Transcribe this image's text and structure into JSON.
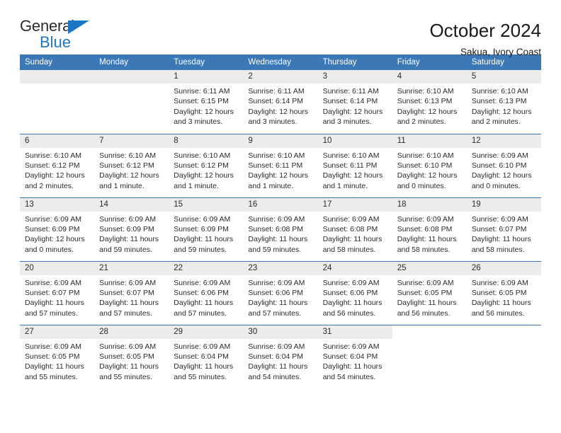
{
  "brand": {
    "name_top": "General",
    "name_bottom": "Blue",
    "accent_color": "#1b77c4"
  },
  "header": {
    "title": "October 2024",
    "subtitle": "Sakua, Ivory Coast"
  },
  "theme": {
    "header_blue": "#3b78b5",
    "daynum_band": "#ececec",
    "text": "#2b2b2b"
  },
  "weekday_headers": [
    "Sunday",
    "Monday",
    "Tuesday",
    "Wednesday",
    "Thursday",
    "Friday",
    "Saturday"
  ],
  "labels": {
    "sunrise_prefix": "Sunrise:",
    "sunset_prefix": "Sunset:",
    "daylight_prefix": "Daylight:"
  },
  "weeks": [
    [
      {
        "day": "",
        "blank": true
      },
      {
        "day": "",
        "blank": true
      },
      {
        "day": "1",
        "sunrise": "Sunrise: 6:11 AM",
        "sunset": "Sunset: 6:15 PM",
        "daylight_1": "Daylight: 12 hours",
        "daylight_2": "and 3 minutes."
      },
      {
        "day": "2",
        "sunrise": "Sunrise: 6:11 AM",
        "sunset": "Sunset: 6:14 PM",
        "daylight_1": "Daylight: 12 hours",
        "daylight_2": "and 3 minutes."
      },
      {
        "day": "3",
        "sunrise": "Sunrise: 6:11 AM",
        "sunset": "Sunset: 6:14 PM",
        "daylight_1": "Daylight: 12 hours",
        "daylight_2": "and 3 minutes."
      },
      {
        "day": "4",
        "sunrise": "Sunrise: 6:10 AM",
        "sunset": "Sunset: 6:13 PM",
        "daylight_1": "Daylight: 12 hours",
        "daylight_2": "and 2 minutes."
      },
      {
        "day": "5",
        "sunrise": "Sunrise: 6:10 AM",
        "sunset": "Sunset: 6:13 PM",
        "daylight_1": "Daylight: 12 hours",
        "daylight_2": "and 2 minutes."
      }
    ],
    [
      {
        "day": "6",
        "sunrise": "Sunrise: 6:10 AM",
        "sunset": "Sunset: 6:12 PM",
        "daylight_1": "Daylight: 12 hours",
        "daylight_2": "and 2 minutes."
      },
      {
        "day": "7",
        "sunrise": "Sunrise: 6:10 AM",
        "sunset": "Sunset: 6:12 PM",
        "daylight_1": "Daylight: 12 hours",
        "daylight_2": "and 1 minute."
      },
      {
        "day": "8",
        "sunrise": "Sunrise: 6:10 AM",
        "sunset": "Sunset: 6:12 PM",
        "daylight_1": "Daylight: 12 hours",
        "daylight_2": "and 1 minute."
      },
      {
        "day": "9",
        "sunrise": "Sunrise: 6:10 AM",
        "sunset": "Sunset: 6:11 PM",
        "daylight_1": "Daylight: 12 hours",
        "daylight_2": "and 1 minute."
      },
      {
        "day": "10",
        "sunrise": "Sunrise: 6:10 AM",
        "sunset": "Sunset: 6:11 PM",
        "daylight_1": "Daylight: 12 hours",
        "daylight_2": "and 1 minute."
      },
      {
        "day": "11",
        "sunrise": "Sunrise: 6:10 AM",
        "sunset": "Sunset: 6:10 PM",
        "daylight_1": "Daylight: 12 hours",
        "daylight_2": "and 0 minutes."
      },
      {
        "day": "12",
        "sunrise": "Sunrise: 6:09 AM",
        "sunset": "Sunset: 6:10 PM",
        "daylight_1": "Daylight: 12 hours",
        "daylight_2": "and 0 minutes."
      }
    ],
    [
      {
        "day": "13",
        "sunrise": "Sunrise: 6:09 AM",
        "sunset": "Sunset: 6:09 PM",
        "daylight_1": "Daylight: 12 hours",
        "daylight_2": "and 0 minutes."
      },
      {
        "day": "14",
        "sunrise": "Sunrise: 6:09 AM",
        "sunset": "Sunset: 6:09 PM",
        "daylight_1": "Daylight: 11 hours",
        "daylight_2": "and 59 minutes."
      },
      {
        "day": "15",
        "sunrise": "Sunrise: 6:09 AM",
        "sunset": "Sunset: 6:09 PM",
        "daylight_1": "Daylight: 11 hours",
        "daylight_2": "and 59 minutes."
      },
      {
        "day": "16",
        "sunrise": "Sunrise: 6:09 AM",
        "sunset": "Sunset: 6:08 PM",
        "daylight_1": "Daylight: 11 hours",
        "daylight_2": "and 59 minutes."
      },
      {
        "day": "17",
        "sunrise": "Sunrise: 6:09 AM",
        "sunset": "Sunset: 6:08 PM",
        "daylight_1": "Daylight: 11 hours",
        "daylight_2": "and 58 minutes."
      },
      {
        "day": "18",
        "sunrise": "Sunrise: 6:09 AM",
        "sunset": "Sunset: 6:08 PM",
        "daylight_1": "Daylight: 11 hours",
        "daylight_2": "and 58 minutes."
      },
      {
        "day": "19",
        "sunrise": "Sunrise: 6:09 AM",
        "sunset": "Sunset: 6:07 PM",
        "daylight_1": "Daylight: 11 hours",
        "daylight_2": "and 58 minutes."
      }
    ],
    [
      {
        "day": "20",
        "sunrise": "Sunrise: 6:09 AM",
        "sunset": "Sunset: 6:07 PM",
        "daylight_1": "Daylight: 11 hours",
        "daylight_2": "and 57 minutes."
      },
      {
        "day": "21",
        "sunrise": "Sunrise: 6:09 AM",
        "sunset": "Sunset: 6:07 PM",
        "daylight_1": "Daylight: 11 hours",
        "daylight_2": "and 57 minutes."
      },
      {
        "day": "22",
        "sunrise": "Sunrise: 6:09 AM",
        "sunset": "Sunset: 6:06 PM",
        "daylight_1": "Daylight: 11 hours",
        "daylight_2": "and 57 minutes."
      },
      {
        "day": "23",
        "sunrise": "Sunrise: 6:09 AM",
        "sunset": "Sunset: 6:06 PM",
        "daylight_1": "Daylight: 11 hours",
        "daylight_2": "and 57 minutes."
      },
      {
        "day": "24",
        "sunrise": "Sunrise: 6:09 AM",
        "sunset": "Sunset: 6:06 PM",
        "daylight_1": "Daylight: 11 hours",
        "daylight_2": "and 56 minutes."
      },
      {
        "day": "25",
        "sunrise": "Sunrise: 6:09 AM",
        "sunset": "Sunset: 6:05 PM",
        "daylight_1": "Daylight: 11 hours",
        "daylight_2": "and 56 minutes."
      },
      {
        "day": "26",
        "sunrise": "Sunrise: 6:09 AM",
        "sunset": "Sunset: 6:05 PM",
        "daylight_1": "Daylight: 11 hours",
        "daylight_2": "and 56 minutes."
      }
    ],
    [
      {
        "day": "27",
        "sunrise": "Sunrise: 6:09 AM",
        "sunset": "Sunset: 6:05 PM",
        "daylight_1": "Daylight: 11 hours",
        "daylight_2": "and 55 minutes."
      },
      {
        "day": "28",
        "sunrise": "Sunrise: 6:09 AM",
        "sunset": "Sunset: 6:05 PM",
        "daylight_1": "Daylight: 11 hours",
        "daylight_2": "and 55 minutes."
      },
      {
        "day": "29",
        "sunrise": "Sunrise: 6:09 AM",
        "sunset": "Sunset: 6:04 PM",
        "daylight_1": "Daylight: 11 hours",
        "daylight_2": "and 55 minutes."
      },
      {
        "day": "30",
        "sunrise": "Sunrise: 6:09 AM",
        "sunset": "Sunset: 6:04 PM",
        "daylight_1": "Daylight: 11 hours",
        "daylight_2": "and 54 minutes."
      },
      {
        "day": "31",
        "sunrise": "Sunrise: 6:09 AM",
        "sunset": "Sunset: 6:04 PM",
        "daylight_1": "Daylight: 11 hours",
        "daylight_2": "and 54 minutes."
      },
      {
        "day": "",
        "void": true
      },
      {
        "day": "",
        "void": true
      }
    ]
  ]
}
